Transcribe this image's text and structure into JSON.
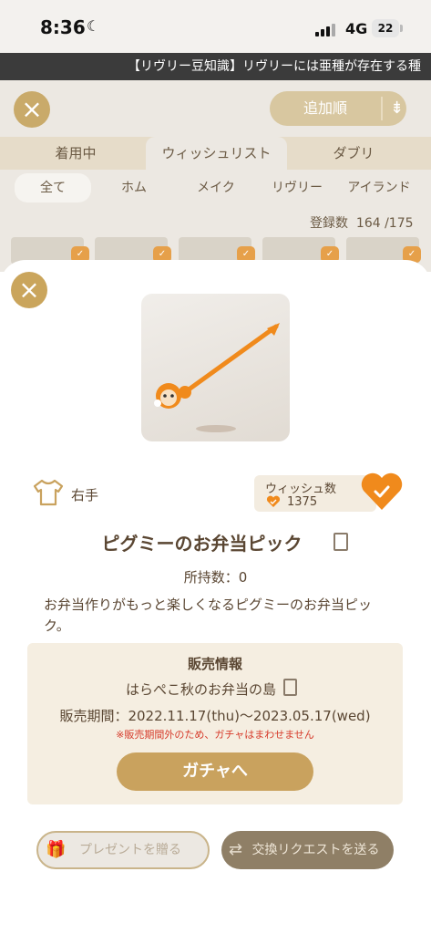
{
  "status_bar": {
    "time": "8:36",
    "network": "4G",
    "battery": "22"
  },
  "marquee": {
    "text": "【リヴリー豆知識】リヴリーには亜種が存在する種"
  },
  "background": {
    "sort_label": "追加順",
    "tabs": [
      "着用中",
      "ウィッシュリスト",
      "ダブリ"
    ],
    "categories": [
      "全て",
      "ホム",
      "メイク",
      "リヴリー",
      "アイランド"
    ],
    "count_label": "登録数",
    "count_value": "164 /175"
  },
  "item": {
    "slot": "右手",
    "wish_label": "ウィッシュ数",
    "wish_count": "1375",
    "name": "ピグミーのお弁当ピック",
    "owned": "所持数：0",
    "description": "お弁当作りがもっと楽しくなるピグミーのお弁当ピック。"
  },
  "sales": {
    "title": "販売情報",
    "event": "はらぺこ秋のお弁当の島",
    "period": "販売期間：2022.11.17(thu)〜2023.05.17(wed)",
    "notice": "※販売期間外のため、ガチャはまわせません",
    "gacha_button": "ガチャへ"
  },
  "actions": {
    "present_button": "プレゼントを贈る",
    "trade_button": "交換リクエストを送る"
  },
  "colors": {
    "accent": "#c9a25e",
    "heart": "#f08a1c",
    "notice": "#d63a2a"
  }
}
